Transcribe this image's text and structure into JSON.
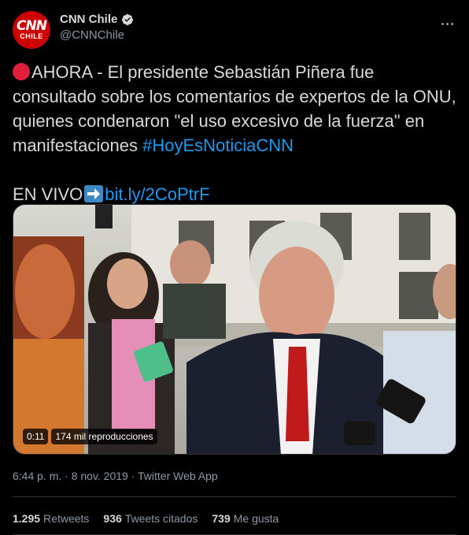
{
  "author": {
    "avatar_top": "CNN",
    "avatar_bottom": "CHILE",
    "display_name": "CNN Chile",
    "handle": "@CNNChile"
  },
  "tweet": {
    "line1_prefix": "AHORA - El presidente Sebastián Piñera fue consultado sobre los comentarios de expertos de la ONU, quienes condenaron \"el uso excesivo de la fuerza\" en manifestaciones ",
    "hashtag": "#HoyEsNoticiaCNN",
    "live_label": "EN VIVO",
    "link": "bit.ly/2CoPtrF"
  },
  "video": {
    "duration": "0:11",
    "views": "174 mil reproducciones"
  },
  "meta": {
    "timestamp": "6:44 p. m. · 8 nov. 2019 · Twitter Web App"
  },
  "stats": {
    "retweets_count": "1.295",
    "retweets_label": "Retweets",
    "quotes_count": "936",
    "quotes_label": "Tweets citados",
    "likes_count": "739",
    "likes_label": "Me gusta"
  },
  "colors": {
    "background": "#000000",
    "link": "#1d9bf0",
    "brand_red": "#cc0000"
  }
}
